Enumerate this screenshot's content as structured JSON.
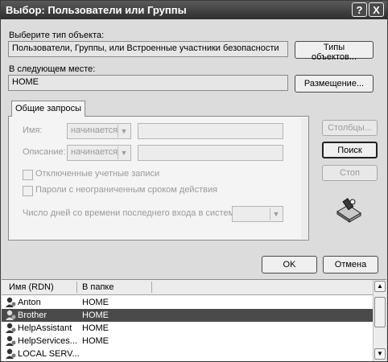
{
  "window": {
    "title": "Выбор: Пользователи или Группы",
    "help_label": "?",
    "close_label": "X"
  },
  "object_type": {
    "label": "Выберите тип объекта:",
    "value": "Пользователи, Группы, или Встроенные участники безопасности",
    "button": "Типы объектов..."
  },
  "location": {
    "label": "В следующем месте:",
    "value": "HOME",
    "button": "Размещение..."
  },
  "tab": {
    "label": "Общие запросы"
  },
  "query": {
    "name_label": "Имя:",
    "name_mode": "начинается",
    "desc_label": "Описание:",
    "desc_mode": "начинается",
    "disabled_accounts": "Отключенные учетные записи",
    "no_expire_pw": "Пароли с неограниченным сроком действия",
    "days_label": "Число дней со времени последнего входа в систему:"
  },
  "side_buttons": {
    "columns": "Столбцы...",
    "search": "Поиск",
    "stop": "Стоп"
  },
  "ok": "OK",
  "cancel": "Отмена",
  "results": {
    "col_name": "Имя (RDN)",
    "col_folder": "В папке",
    "rows": [
      {
        "name": "Anton",
        "folder": "HOME",
        "selected": false
      },
      {
        "name": "Brother",
        "folder": "HOME",
        "selected": true
      },
      {
        "name": "HelpAssistant",
        "folder": "HOME",
        "selected": false
      },
      {
        "name": "HelpServices...",
        "folder": "HOME",
        "selected": false
      },
      {
        "name": "LOCAL SERV...",
        "folder": "",
        "selected": false
      }
    ]
  },
  "icons": {
    "help": "question-icon",
    "close": "close-icon",
    "search_art": "search-flashlight-icon",
    "user": "user-icon"
  }
}
